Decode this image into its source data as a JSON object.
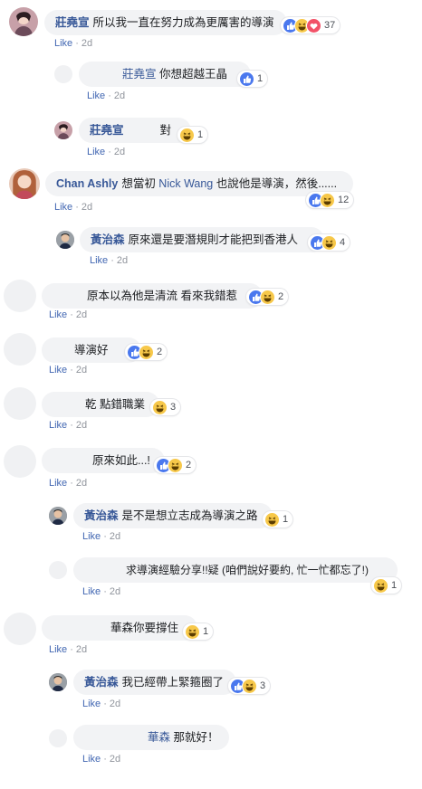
{
  "like_label": "Like",
  "comments": [
    {
      "id": "c1",
      "name": "莊堯宣",
      "text": "所以我一直在努力成為更厲害的導演",
      "time": "2d",
      "reactions": [
        "like",
        "haha",
        "love"
      ],
      "count": "37"
    },
    {
      "id": "r1",
      "tag": "莊堯宣",
      "text": "你想超越王晶",
      "time": "2d",
      "reactions": [
        "like"
      ],
      "count": "1"
    },
    {
      "id": "r2",
      "name": "莊堯宣",
      "text": "對",
      "time": "2d",
      "reactions": [
        "haha"
      ],
      "count": "1"
    },
    {
      "id": "c2",
      "name": "Chan Ashly",
      "text_pre": "想當初 ",
      "tag": "Nick Wang",
      "text_post": " 也說他是導演，然後......",
      "time": "2d",
      "reactions": [
        "like",
        "haha"
      ],
      "count": "12"
    },
    {
      "id": "r3",
      "name": "黃治森",
      "text": "原來還是要潛規則才能把到香港人",
      "time": "2d",
      "reactions": [
        "like",
        "haha"
      ],
      "count": "4"
    },
    {
      "id": "c3",
      "text": "原本以為他是清流 看來我錯惹",
      "time": "2d",
      "reactions": [
        "like",
        "haha"
      ],
      "count": "2"
    },
    {
      "id": "c4",
      "text": "導演好",
      "time": "2d",
      "reactions": [
        "like",
        "haha"
      ],
      "count": "2"
    },
    {
      "id": "c5",
      "text": "乾 點錯職業",
      "time": "2d",
      "reactions": [
        "haha"
      ],
      "count": "3"
    },
    {
      "id": "c6",
      "text": "原來如此...!",
      "time": "2d",
      "reactions": [
        "like",
        "haha"
      ],
      "count": "2"
    },
    {
      "id": "r4",
      "name": "黃治森",
      "text": "是不是想立志成為導演之路",
      "time": "2d",
      "reactions": [
        "haha"
      ],
      "count": "1"
    },
    {
      "id": "r5",
      "text": "求導演經驗分享!!疑 (咱們說好要約, 忙一忙都忘了!)",
      "time": "2d",
      "reactions": [
        "haha"
      ],
      "count": "1"
    },
    {
      "id": "c7",
      "text": "華森你要撐住",
      "time": "2d",
      "reactions": [
        "haha"
      ],
      "count": "1"
    },
    {
      "id": "r6",
      "name": "黃治森",
      "text": "我已經帶上緊箍圈了",
      "time": "2d",
      "reactions": [
        "like",
        "haha"
      ],
      "count": "3"
    },
    {
      "id": "r7",
      "tag": "華森",
      "text": "那就好！",
      "time": "2d",
      "reactions": [],
      "count": ""
    }
  ]
}
